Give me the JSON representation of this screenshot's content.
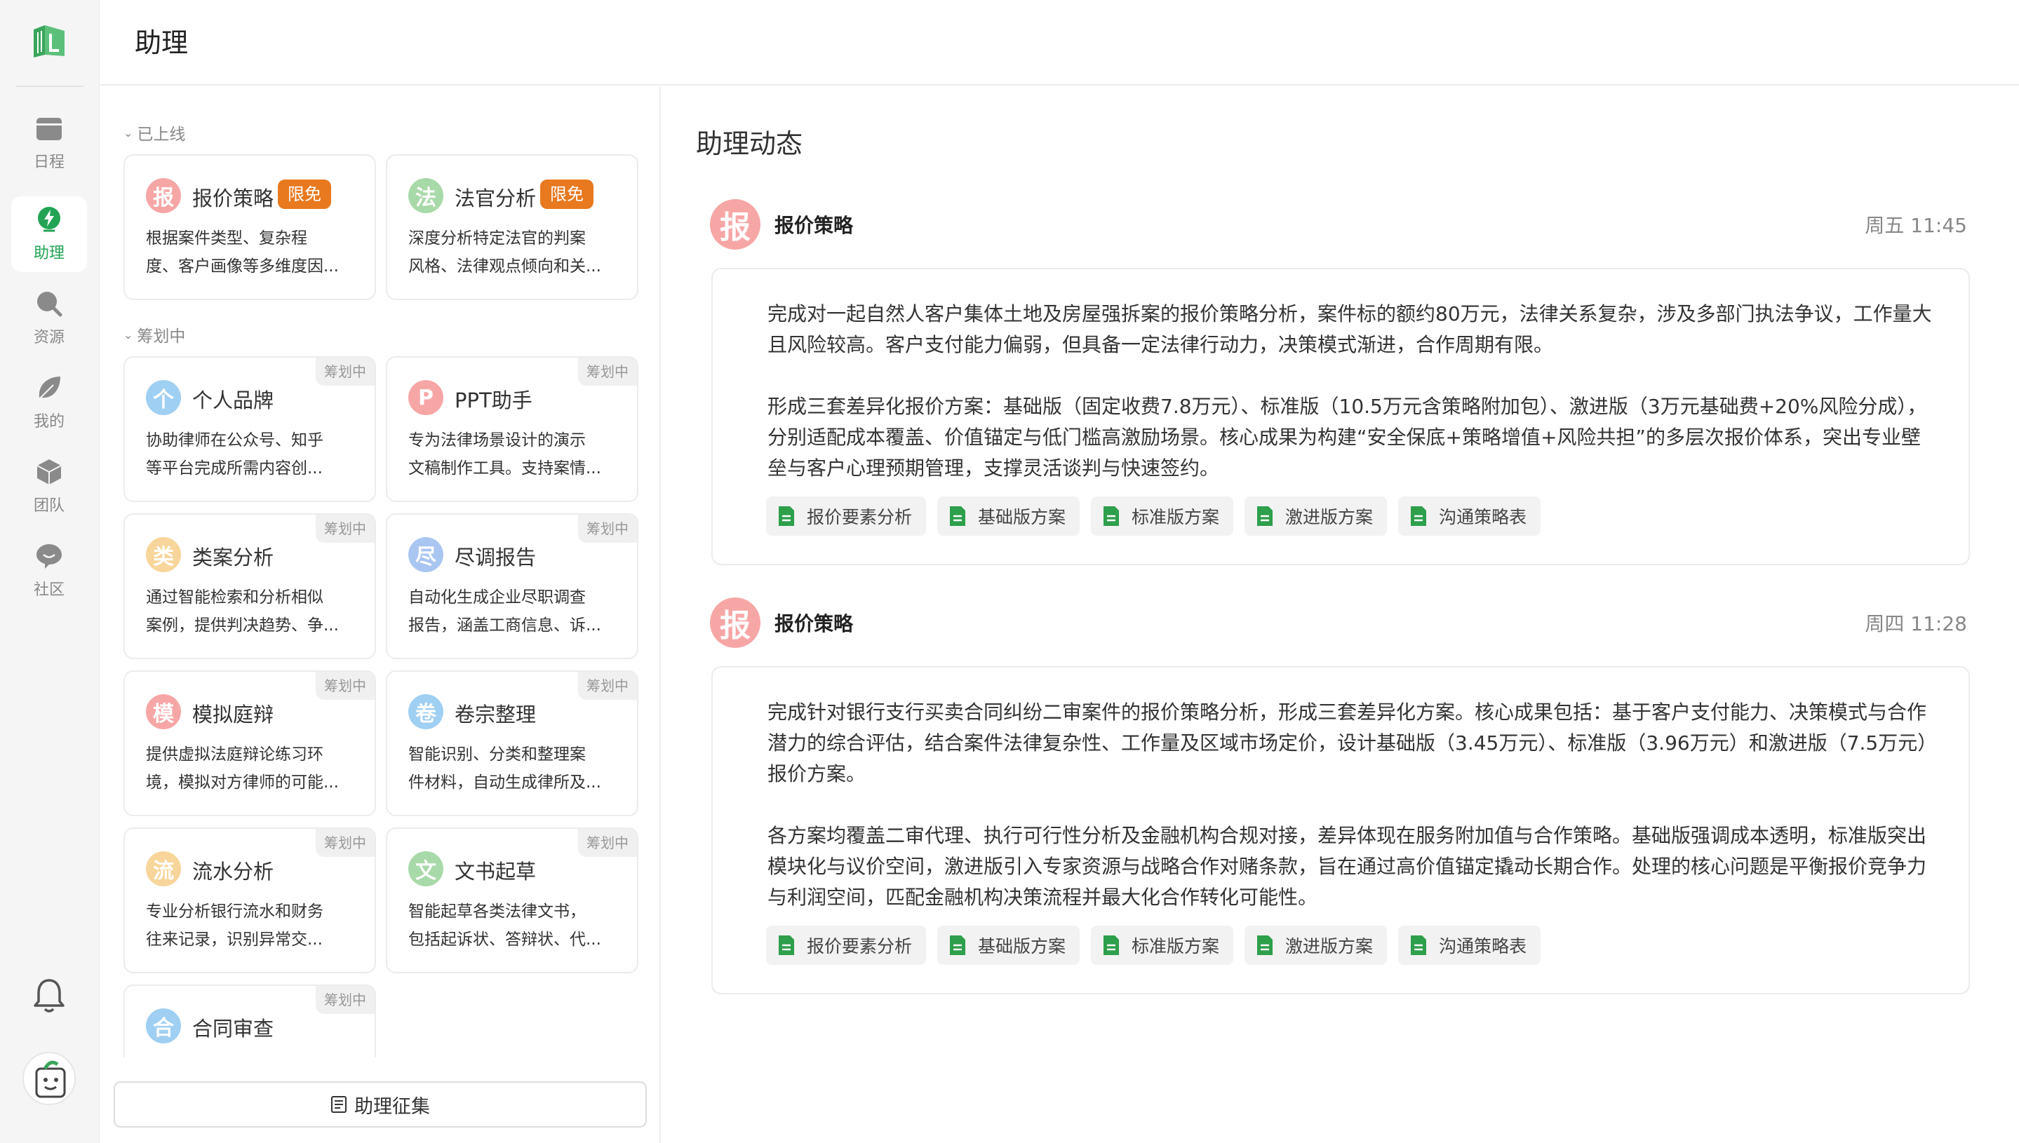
{
  "app": {
    "title": "助理"
  },
  "nav": {
    "items": [
      {
        "label": "日程",
        "icon": "calendar-icon"
      },
      {
        "label": "助理",
        "icon": "assistant-bolt-icon",
        "active": true
      },
      {
        "label": "资源",
        "icon": "search-icon"
      },
      {
        "label": "我的",
        "icon": "leaf-icon"
      },
      {
        "label": "团队",
        "icon": "cube-icon"
      },
      {
        "label": "社区",
        "icon": "chat-bubble-icon"
      }
    ]
  },
  "middle": {
    "online_label": "已上线",
    "planning_label": "筹划中",
    "free_badge": "限免",
    "planning_badge": "筹划中",
    "online_cards": [
      {
        "title": "报价策略",
        "icon_char": "报",
        "icon_color": "#f7a6a6",
        "desc1": "根据案件类型、复杂程",
        "desc2": "度、客户画像等多维度因..."
      },
      {
        "title": "法官分析",
        "icon_char": "法",
        "icon_color": "#a8d9a8",
        "desc1": "深度分析特定法官的判案",
        "desc2": "风格、法律观点倾向和关..."
      }
    ],
    "planning_cards": [
      {
        "title": "个人品牌",
        "icon_char": "个",
        "icon_color": "#9fcff2",
        "desc1": "协助律师在公众号、知乎",
        "desc2": "等平台完成所需内容创..."
      },
      {
        "title": "PPT助手",
        "icon_char": "P",
        "icon_color": "#f7a6a6",
        "desc1": "专为法律场景设计的演示",
        "desc2": "文稿制作工具。支持案情..."
      },
      {
        "title": "类案分析",
        "icon_char": "类",
        "icon_color": "#f8d59a",
        "desc1": "通过智能检索和分析相似",
        "desc2": "案例，提供判决趋势、争..."
      },
      {
        "title": "尽调报告",
        "icon_char": "尽",
        "icon_color": "#a9c6f2",
        "desc1": "自动化生成企业尽职调查",
        "desc2": "报告，涵盖工商信息、诉..."
      },
      {
        "title": "模拟庭辩",
        "icon_char": "模",
        "icon_color": "#f7a6a6",
        "desc1": "提供虚拟法庭辩论练习环",
        "desc2": "境，模拟对方律师的可能..."
      },
      {
        "title": "卷宗整理",
        "icon_char": "卷",
        "icon_color": "#9fcff2",
        "desc1": "智能识别、分类和整理案",
        "desc2": "件材料，自动生成律所及..."
      },
      {
        "title": "流水分析",
        "icon_char": "流",
        "icon_color": "#f8d59a",
        "desc1": "专业分析银行流水和财务",
        "desc2": "往来记录，识别异常交..."
      },
      {
        "title": "文书起草",
        "icon_char": "文",
        "icon_color": "#a8d9a8",
        "desc1": "智能起草各类法律文书，",
        "desc2": "包括起诉状、答辩状、代..."
      },
      {
        "title": "合同审查",
        "icon_char": "合",
        "icon_color": "#9fcff2",
        "desc1": "",
        "desc2": ""
      }
    ],
    "collect_button": "助理征集"
  },
  "feed": {
    "title": "助理动态",
    "entries": [
      {
        "name": "报价策略",
        "avatar_char": "报",
        "time": "周五 11:45",
        "p1": "完成对一起自然人客户集体土地及房屋强拆案的报价策略分析，案件标的额约80万元，法律关系复杂，涉及多部门执法争议，工作量大且风险较高。客户支付能力偏弱，但具备一定法律行动力，决策模式渐进，合作周期有限。",
        "p2": "形成三套差异化报价方案：基础版（固定收费7.8万元）、标准版（10.5万元含策略附加包）、激进版（3万元基础费+20%风险分成），分别适配成本覆盖、价值锚定与低门槛高激励场景。核心成果为构建“安全保底+策略增值+风险共担”的多层次报价体系，突出专业壁垒与客户心理预期管理，支撑灵活谈判与快速签约。",
        "chips": [
          "报价要素分析",
          "基础版方案",
          "标准版方案",
          "激进版方案",
          "沟通策略表"
        ]
      },
      {
        "name": "报价策略",
        "avatar_char": "报",
        "time": "周四 11:28",
        "p1": "完成针对银行支行买卖合同纠纷二审案件的报价策略分析，形成三套差异化方案。核心成果包括：基于客户支付能力、决策模式与合作潜力的综合评估，结合案件法律复杂性、工作量及区域市场定价，设计基础版（3.45万元）、标准版（3.96万元）和激进版（7.5万元）报价方案。",
        "p2": "各方案均覆盖二审代理、执行可行性分析及金融机构合规对接，差异体现在服务附加值与合作策略。基础版强调成本透明，标准版突出模块化与议价空间，激进版引入专家资源与战略合作对赌条款，旨在通过高价值锚定撬动长期合作。处理的核心问题是平衡报价竞争力与利润空间，匹配金融机构决策流程并最大化合作转化可能性。",
        "chips": [
          "报价要素分析",
          "基础版方案",
          "标准版方案",
          "激进版方案",
          "沟通策略表"
        ]
      }
    ]
  },
  "colors": {
    "accent": "#22a454",
    "free_badge": "#e8791f",
    "doc_icon": "#2e9f4b"
  }
}
